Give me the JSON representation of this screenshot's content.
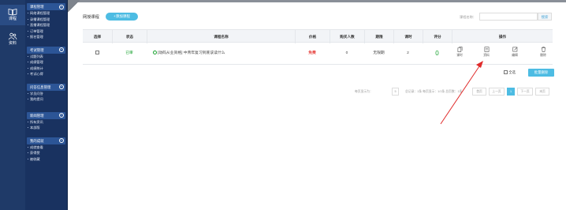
{
  "rail": [
    {
      "label": "课程",
      "icon": "book-icon",
      "active": true
    },
    {
      "label": "资料",
      "icon": "people-icon",
      "active": false
    }
  ],
  "sidebar": [
    {
      "title": "课程管理",
      "toggle": "−",
      "items": [
        "网络课程管理",
        "录播课程管理",
        "直播课程管理",
        "订单管理",
        "报名管理"
      ]
    },
    {
      "title": "考试管理",
      "toggle": "−",
      "items": [
        "试题列表",
        "成绩管理",
        "成绩统计",
        "考试心得"
      ]
    },
    {
      "title": "问答信息管理",
      "toggle": "−",
      "items": [
        "学员问答",
        "我的提问"
      ]
    },
    {
      "title": "新闻管理",
      "toggle": "−",
      "items": [
        "所有资讯",
        "本部版"
      ]
    },
    {
      "title": "我的成就",
      "toggle": "−",
      "items": [
        "成就查看",
        "获得赞",
        "被收藏"
      ]
    }
  ],
  "header": {
    "title": "网授课程",
    "add_label": "+添加课程",
    "search_label": "课程名称：",
    "search_placeholder": "",
    "search_button": "搜索"
  },
  "table": {
    "columns": [
      "选择",
      "状态",
      "课程名称",
      "价格",
      "购买人数",
      "期限",
      "课时",
      "评分",
      "操作"
    ],
    "rows": [
      {
        "status": "已审",
        "name": "[动码从业资格] 中青年复习到底该读什么",
        "price": "免费",
        "buyers": "0",
        "term": "无限期",
        "hours": "2",
        "score": "0",
        "ops": [
          {
            "label": "课时",
            "icon": "copy-icon"
          },
          {
            "label": "资料",
            "icon": "document-icon"
          },
          {
            "label": "编辑",
            "icon": "edit-icon"
          },
          {
            "label": "删除",
            "icon": "trash-icon"
          }
        ]
      }
    ]
  },
  "footer": {
    "select_all": "全选",
    "batch_delete": "批量删除"
  },
  "pager": {
    "per_page_label": "每页显示为：",
    "per_page": "5",
    "summary": "总记录：1条 每页显示：1/1条 总页数：1条",
    "first": "首页",
    "prev": "上一页",
    "current": "1",
    "next": "下一页",
    "last": "末页"
  },
  "colors": {
    "rail_bg": "#1f3a68",
    "sidebar_bg": "#193260",
    "accent": "#4dbce3",
    "status_green": "#19a330",
    "price_red": "#e53935",
    "arrow_red": "#e02b2b"
  }
}
